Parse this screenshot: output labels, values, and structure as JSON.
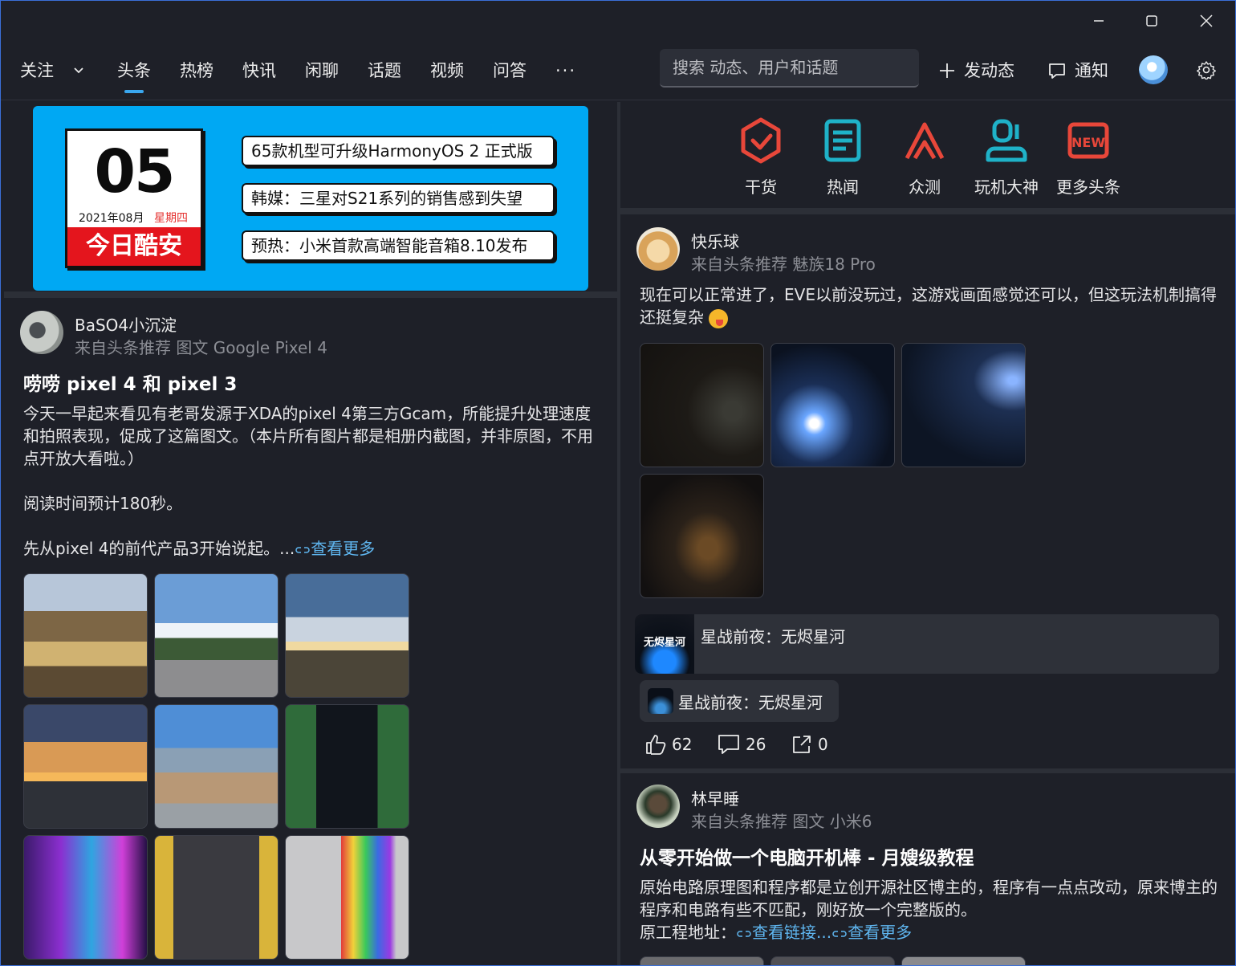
{
  "nav": {
    "follow": "关注",
    "tabs": [
      "头条",
      "热榜",
      "快讯",
      "闲聊",
      "话题",
      "视频",
      "问答"
    ],
    "more": "···",
    "search_placeholder": "搜索 动态、用户和话题",
    "post_label": "发动态",
    "notify_label": "通知"
  },
  "banner": {
    "day": "05",
    "date": "2021年08月",
    "weekday": "星期四",
    "footer": "今日酷安",
    "headlines": [
      "65款机型可升级HarmonyOS 2 正式版",
      "韩媒：三星对S21系列的销售感到失望",
      "预热：小米首款高端智能音箱8.10发布"
    ]
  },
  "categories": [
    {
      "label": "干货",
      "icon": "shield-check-icon",
      "color": "#e8473a"
    },
    {
      "label": "热闻",
      "icon": "document-icon",
      "color": "#1fb2c8"
    },
    {
      "label": "众测",
      "icon": "triangle-test-icon",
      "color": "#e8473a"
    },
    {
      "label": "玩机大神",
      "icon": "user-star-icon",
      "color": "#1fb2c8"
    },
    {
      "label": "更多头条",
      "icon": "new-badge-icon",
      "color": "#e8473a"
    }
  ],
  "post_left": {
    "author": "BaSO4小沉淀",
    "meta": "来自头条推荐  图文 Google Pixel 4",
    "title": "唠唠 pixel 4 和 pixel 3",
    "body": "今天一早起来看见有老哥发源于XDA的pixel 4第三方Gcam，所能提升处理速度和拍照表现，促成了这篇图文。（本片所有图片都是相册内截图，并非原图，不用点开放大看啦。）",
    "reading": "阅读时间预计180秒。",
    "intro": "先从pixel 4的前代产品3开始说起。...",
    "more": "查看更多"
  },
  "post_right1": {
    "author": "快乐球",
    "meta": "来自头条推荐 魅族18 Pro",
    "body": "现在可以正常进了，EVE以前没玩过，这游戏画面感觉还可以，但这玩法机制搞得还挺复杂",
    "game_title": "星战前夜：无烬星河",
    "game_logo": "无烬星河",
    "tag": "星战前夜：无烬星河",
    "likes": "62",
    "comments": "26",
    "shares": "0"
  },
  "post_right2": {
    "author": "林早睡",
    "meta": "来自头条推荐  图文 小米6",
    "title": "从零开始做一个电脑开机棒 - 月嫂级教程",
    "body": "原始电路原理图和程序都是立创开源社区博主的，程序有一点点改动，原来博主的程序和电路有些不匹配，刚好放一个完整版的。",
    "addr_label": "原工程地址：",
    "link1": "查看链接...",
    "link2": "查看更多"
  }
}
